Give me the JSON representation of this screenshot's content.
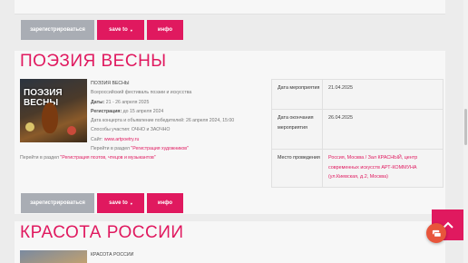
{
  "top_card": {
    "cut_text": "..."
  },
  "buttons": {
    "register": "зарегистрироваться",
    "save_to": "save to",
    "info": "инфо"
  },
  "events": [
    {
      "title": "ПОЭЗИЯ ВЕСНЫ",
      "poster_text": "ПОЭЗИЯ ВЕСНЫ",
      "name": "ПОЭЗИЯ ВЕСНЫ",
      "subtitle": "Всероссийский фестиваль поэзии и искусства",
      "dates_label": "Даты:",
      "dates_value": "21 - 26 апреля 2025",
      "registration_label": "Регистрация:",
      "registration_value": "до 15 апреля 2024",
      "concert_line": "Дата концерта и объявление победителей: 26 апреля 2024, 15:00",
      "participation": "Способы участия: ОЧНО и ЗАОЧНО",
      "site_label": "Сайт:",
      "site_value": "www.artpoetry.ru",
      "artists_prefix": "Перейти в раздел",
      "artists_link": "\"Регистрация художников\"",
      "poets_prefix": "Перейти в раздел",
      "poets_link": "\"Регистрация поэтов, чтецов и музыкантов\"",
      "table": [
        {
          "label": "Дата мероприятия",
          "value": "21.04.2025",
          "pink": false
        },
        {
          "label": "Дата окончания мероприятия",
          "value": "26.04.2025",
          "pink": false
        },
        {
          "label": "Место проведения",
          "value": "Россия, Москва / Зал КРАСНЫЙ, центр современных искусств АРТ-КОММУНА (ул.Киевская, д.2, Москва)",
          "pink": true
        }
      ]
    },
    {
      "title": "КРАСОТА РОССИИ",
      "name": "КРАСОТА РОССИИ"
    }
  ],
  "colors": {
    "accent": "#e0195f",
    "grey_button": "#a9adb4",
    "chat": "#e8553b"
  },
  "icons": {
    "save_caret": "caret-down-icon",
    "to_top": "chevron-up-icon",
    "chat": "chat-icon"
  }
}
